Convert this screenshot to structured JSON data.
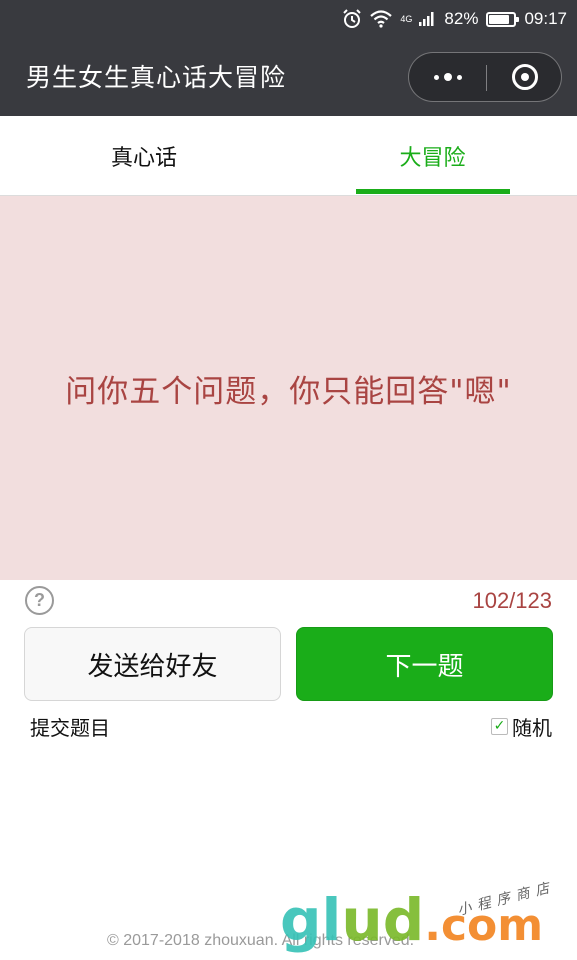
{
  "status_bar": {
    "network": "4G",
    "battery": "82%",
    "battery_level": 0.82,
    "time": "09:17"
  },
  "app_title": "男生女生真心话大冒险",
  "tabs": [
    {
      "label": "真心话",
      "active": false
    },
    {
      "label": "大冒险",
      "active": true
    }
  ],
  "question": "问你五个问题，你只能回答\"嗯\"",
  "counter": "102/123",
  "help_icon_text": "?",
  "buttons": {
    "send": "发送给好友",
    "next": "下一题"
  },
  "submit_link": "提交题目",
  "random": {
    "label": "随机",
    "checked": true
  },
  "footer": "© 2017-2018 zhouxuan. All rights reserved.",
  "watermark": {
    "text_g": "g",
    "text_l": "l",
    "text_u": "u",
    "text_d": "d",
    "dotcom": ".com",
    "sub": "小程序商店"
  },
  "colors": {
    "accent": "#1aad19",
    "question_text": "#a94442",
    "card_bg": "#f2dede",
    "topbar_bg": "#393a3f"
  }
}
